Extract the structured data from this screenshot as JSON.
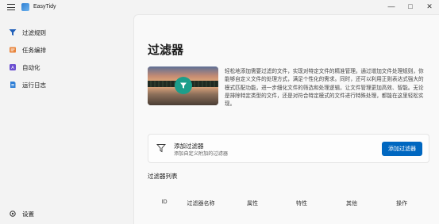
{
  "app": {
    "title": "EasyTidy"
  },
  "window_controls": {
    "minimize": "—",
    "maximize": "□",
    "close": "✕"
  },
  "sidebar": {
    "items": [
      {
        "label": "过滤规则",
        "icon": "filter-icon",
        "active": true
      },
      {
        "label": "任务编排",
        "icon": "task-icon"
      },
      {
        "label": "自动化",
        "icon": "automation-icon"
      },
      {
        "label": "运行日志",
        "icon": "log-icon"
      }
    ],
    "settings_label": "设置"
  },
  "main": {
    "title": "过滤器",
    "description": "轻松地添加需要过滤的文件，实现对特定文件的精准管理。通过增加文件处理规则，你能够自定义文件的处理方式，满足个性化的需求。同时，还可以利用正则表达式强大的模式匹配功能，进一步细化文件的筛选和处理逻辑，让文件管理更加高效、智能。无论是排除特定类型的文件，还是对符合特定模式的文件进行特殊处理，都能在这里轻松实现。",
    "add_card": {
      "title": "添加过滤器",
      "subtitle": "添加自定义附加的过滤器",
      "button_label": "添加过滤器"
    },
    "list_title": "过滤器列表",
    "table_headers": [
      "ID",
      "过滤器名称",
      "属性",
      "特性",
      "其他",
      "操作"
    ]
  },
  "colors": {
    "accent": "#0067c0",
    "badge": "#1c9e8b"
  }
}
